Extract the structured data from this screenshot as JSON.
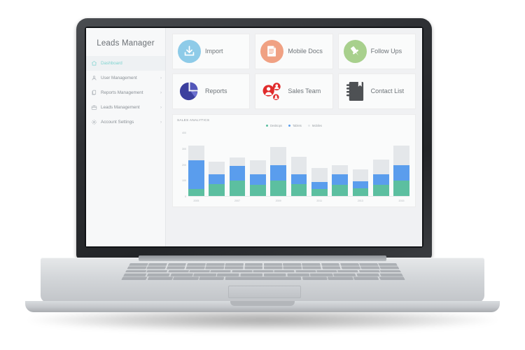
{
  "app": {
    "title": "Leads Manager"
  },
  "sidebar": {
    "items": [
      {
        "label": "Dashboard",
        "icon": "home-icon",
        "active": true,
        "chevron": ""
      },
      {
        "label": "User Management",
        "icon": "user-icon",
        "active": false,
        "chevron": "›"
      },
      {
        "label": "Reports Management",
        "icon": "documents-icon",
        "active": false,
        "chevron": "›"
      },
      {
        "label": "Leads Management",
        "icon": "briefcase-icon",
        "active": false,
        "chevron": "›"
      },
      {
        "label": "Account Settings",
        "icon": "gear-icon",
        "active": false,
        "chevron": "›"
      }
    ]
  },
  "cards": [
    {
      "label": "Import",
      "icon": "download-icon",
      "color": "#8ecbe8"
    },
    {
      "label": "Mobile Docs",
      "icon": "document-icon",
      "color": "#f0a183"
    },
    {
      "label": "Follow Ups",
      "icon": "pushpin-icon",
      "color": "#a8d08d"
    },
    {
      "label": "Reports",
      "icon": "pie-chart-icon",
      "color": "#3b3f9e"
    },
    {
      "label": "Sales Team",
      "icon": "people-icon",
      "color": "#e02b2b"
    },
    {
      "label": "Contact List",
      "icon": "notebook-icon",
      "color": "#4e5154"
    }
  ],
  "chart_data": {
    "type": "bar",
    "title": "SALES ANALYTICS",
    "stacked": true,
    "xlabel": "",
    "ylabel": "",
    "ylim": [
      0,
      400
    ],
    "yticks": [
      0,
      100,
      200,
      300,
      400
    ],
    "grid": false,
    "legend_position": "top-center",
    "categories": [
      "2005",
      "2006",
      "2007",
      "2008",
      "2009",
      "2010",
      "2011",
      "2012",
      "2013",
      "2014",
      "2015"
    ],
    "tick_labels": [
      "2005",
      "",
      "2007",
      "",
      "2009",
      "",
      "2011",
      "",
      "2013",
      "",
      "2015"
    ],
    "series": [
      {
        "name": "Desktops",
        "color": "#5cbfa0",
        "values": [
          45,
          75,
          100,
          70,
          100,
          75,
          45,
          70,
          50,
          70,
          100
        ]
      },
      {
        "name": "Tablets",
        "color": "#5a9ded",
        "values": [
          180,
          65,
          90,
          70,
          95,
          65,
          45,
          70,
          45,
          70,
          95
        ]
      },
      {
        "name": "Mobiles",
        "color": "#e4e7ea",
        "values": [
          95,
          80,
          55,
          85,
          115,
          110,
          90,
          55,
          75,
          90,
          125
        ]
      }
    ]
  }
}
